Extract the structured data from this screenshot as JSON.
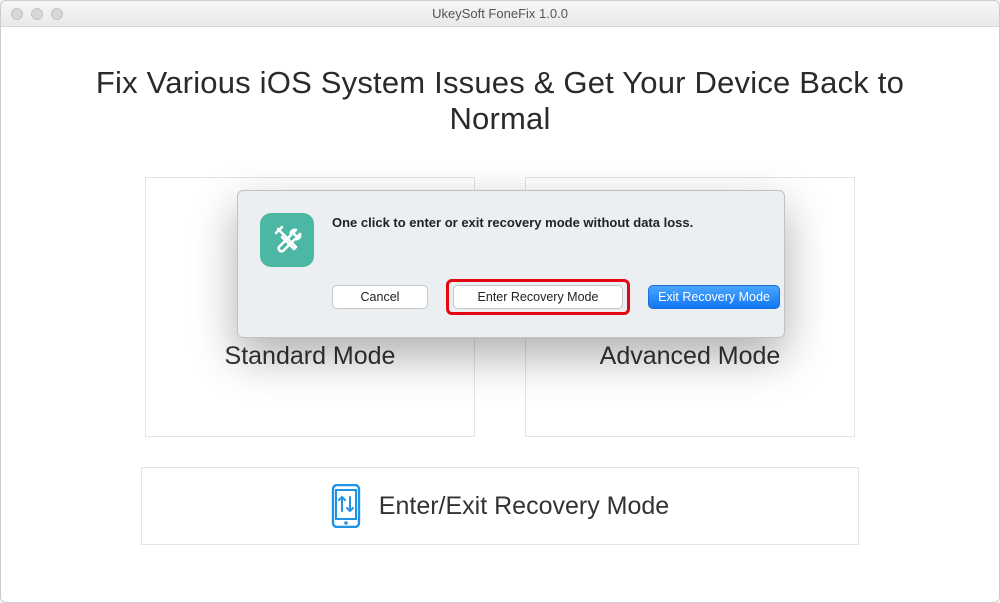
{
  "window": {
    "title": "UkeySoft FoneFix 1.0.0"
  },
  "main": {
    "headline": "Fix Various iOS System Issues & Get Your Device Back to Normal",
    "cards": {
      "standard": "Standard Mode",
      "advanced": "Advanced Mode"
    },
    "bottom": "Enter/Exit Recovery Mode"
  },
  "modal": {
    "message": "One click to enter or exit recovery mode without data loss.",
    "cancel": "Cancel",
    "enter": "Enter Recovery Mode",
    "exit": "Exit Recovery Mode"
  },
  "colors": {
    "accent_blue": "#1f93e6",
    "button_blue": "#1176f3",
    "highlight_red": "#e30613",
    "icon_teal": "#4db7a5"
  }
}
